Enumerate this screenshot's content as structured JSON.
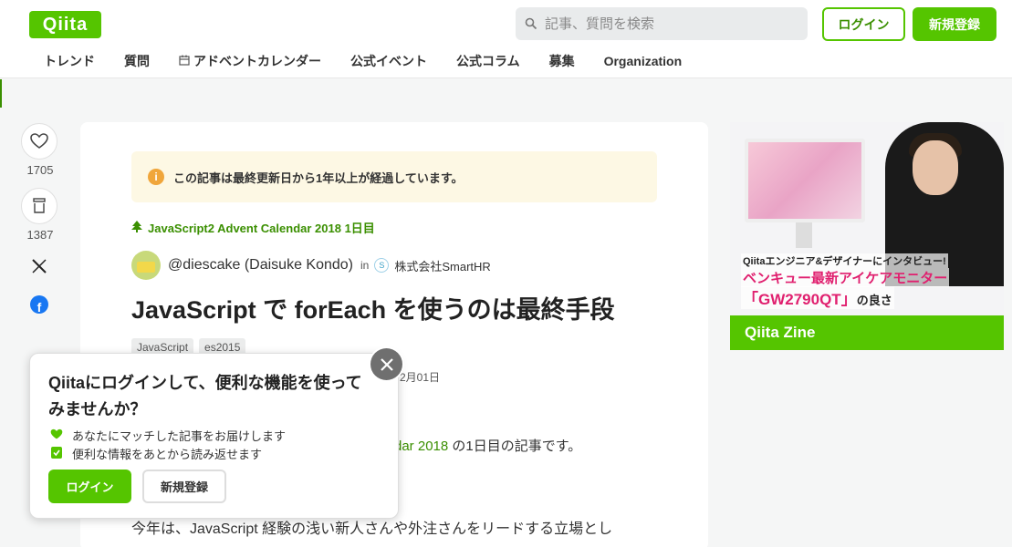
{
  "header": {
    "logo": "Qiita",
    "search_placeholder": "記事、質問を検索",
    "login": "ログイン",
    "signup": "新規登録"
  },
  "nav": {
    "items": [
      "トレンド",
      "質問",
      "アドベントカレンダー",
      "公式イベント",
      "公式コラム",
      "募集",
      "Organization"
    ]
  },
  "side": {
    "likes": "1705",
    "stocks": "1387"
  },
  "article": {
    "notice": "この記事は最終更新日から1年以上が経過しています。",
    "advent": "JavaScript2 Advent Calendar 2018 1日目",
    "author": "@diescake (Daisuke Kondo)",
    "in": "in",
    "org": "株式会社SmartHR",
    "title": "JavaScript で forEach を使うのは最終手段",
    "tags": [
      "JavaScript",
      "es2015"
    ],
    "date_partial": "2月01日",
    "body1_link": "dar 2018",
    "body1_rest": " の1日目の記事です。",
    "body2": "今年は、JavaScript 経験の浅い新人さんや外注さんをリードする立場とし"
  },
  "ad": {
    "line1": "Qiitaエンジニア&デザイナーにインタビュー!",
    "line2": "ベンキュー最新アイケアモニター",
    "line3": "「GW2790QT」",
    "line3_suffix": "の良さ",
    "footer": "Qiita Zine"
  },
  "popup": {
    "title": "Qiitaにログインして、便利な機能を使ってみませんか？",
    "benefit1": "あなたにマッチした記事をお届けします",
    "benefit2": "便利な情報をあとから読み返せます",
    "login": "ログイン",
    "signup": "新規登録"
  },
  "colors": {
    "brand": "#55c500",
    "link": "#3a8f00"
  }
}
